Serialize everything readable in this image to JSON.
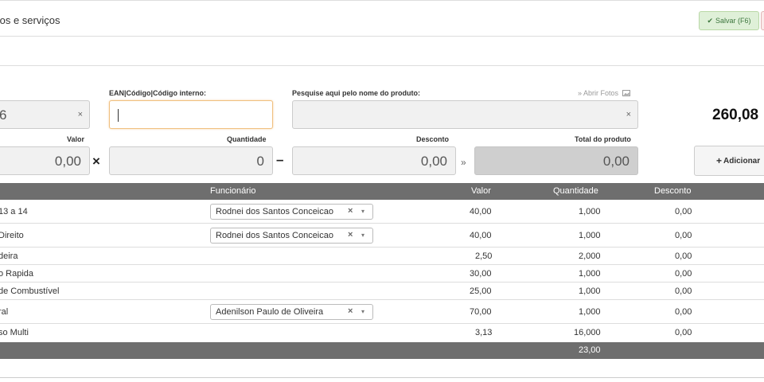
{
  "header": {
    "title": "tos e serviços",
    "save_label": "Salvar (F6)"
  },
  "form": {
    "code_partial": "6",
    "ean_label": "EAN|Código|Código interno:",
    "ean_value": "",
    "search_label": "Pesquise aqui pelo nome do produto:",
    "photos_link": "» Abrir Fotos",
    "grand_total": "260,08",
    "valor_label": "Valor",
    "valor_value": "0,00",
    "times_symbol": "×",
    "quantidade_label": "Quantidade",
    "quantidade_value": "0",
    "minus_symbol": "–",
    "desconto_label": "Desconto",
    "desconto_value": "0,00",
    "raquo_symbol": "»",
    "total_label": "Total do produto",
    "total_value": "0,00",
    "add_label": "Adicionar",
    "add_plus": "+"
  },
  "table": {
    "headers": {
      "funcionario": "Funcionário",
      "valor": "Valor",
      "quantidade": "Quantidade",
      "desconto": "Desconto"
    },
    "rows": [
      {
        "item": "13 a 14",
        "employee": "Rodnei dos Santos Conceicao",
        "valor": "40,00",
        "quantidade": "1,000",
        "desconto": "0,00"
      },
      {
        "item": "Direito",
        "employee": "Rodnei dos Santos Conceicao",
        "valor": "40,00",
        "quantidade": "1,000",
        "desconto": "0,00"
      },
      {
        "item": "deira",
        "employee": "",
        "valor": "2,50",
        "quantidade": "2,000",
        "desconto": "0,00"
      },
      {
        "item": "o Rapida",
        "employee": "",
        "valor": "30,00",
        "quantidade": "1,000",
        "desconto": "0,00"
      },
      {
        "item": "de Combustível",
        "employee": "",
        "valor": "25,00",
        "quantidade": "1,000",
        "desconto": "0,00"
      },
      {
        "item": "ral",
        "employee": "Adenilson Paulo de Oliveira",
        "valor": "70,00",
        "quantidade": "1,000",
        "desconto": "0,00"
      },
      {
        "item": "so Multi",
        "employee": "",
        "valor": "3,13",
        "quantidade": "16,000",
        "desconto": "0,00"
      }
    ],
    "footer_quantity": "23,00"
  },
  "icons": {
    "clear": "×",
    "dropdown": "▾",
    "check": "✔"
  }
}
